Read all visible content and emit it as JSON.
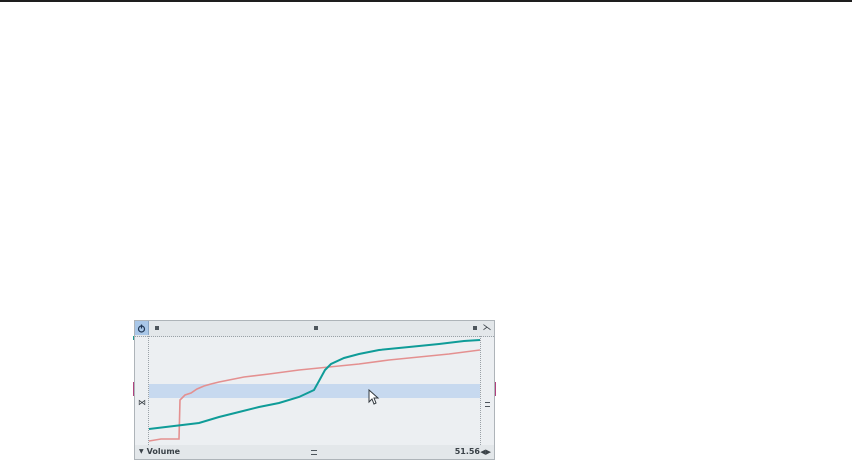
{
  "lane": {
    "parameter_label": "Volume",
    "value_readout": "51.56",
    "icons": {
      "power": "power-icon",
      "close": "close-icon",
      "collapse": "collapse-icon",
      "dropdown": "chevron-down-icon",
      "stepper": "stepper-arrows-icon",
      "cursor": "cursor-arrow-icon"
    },
    "colors": {
      "teal_curve": "#0f9c98",
      "pink_curve": "#e49090",
      "selection_band": "#c7d9ef",
      "power_active": "#a9c7e8",
      "side_marker": "#b0417e"
    }
  }
}
